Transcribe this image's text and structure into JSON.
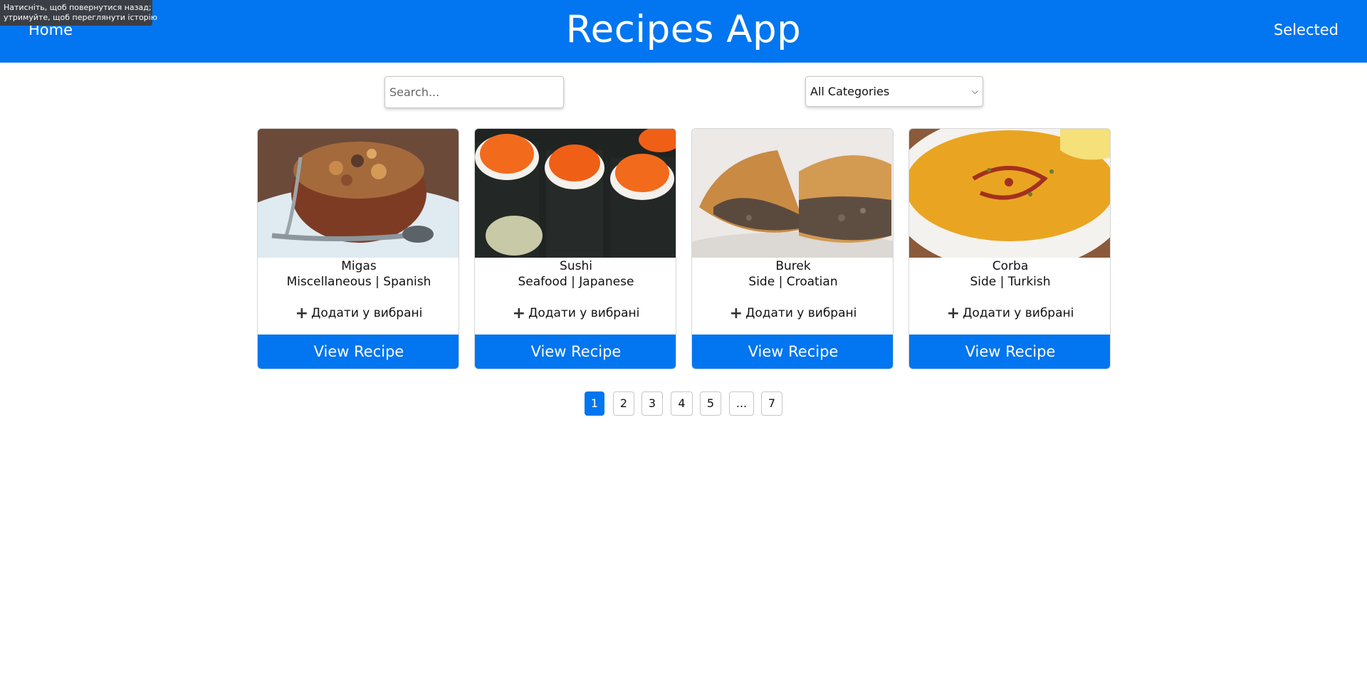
{
  "tooltip": {
    "line1": "Натисніть, щоб повернутися назад;",
    "line2": "утримуйте, щоб переглянути історію"
  },
  "header": {
    "home_label": "Home",
    "title": "Recipes App",
    "selected_label": "Selected"
  },
  "controls": {
    "search_placeholder": "Search...",
    "category_selected": "All Categories"
  },
  "cards": [
    {
      "title": "Migas",
      "meta": "Miscellaneous | Spanish",
      "fav_label": "Додати у вибрані",
      "view_label": "View Recipe",
      "image": "migas-dish-photo"
    },
    {
      "title": "Sushi",
      "meta": "Seafood | Japanese",
      "fav_label": "Додати у вибрані",
      "view_label": "View Recipe",
      "image": "sushi-rolls-photo"
    },
    {
      "title": "Burek",
      "meta": "Side | Croatian",
      "fav_label": "Додати у вибрані",
      "view_label": "View Recipe",
      "image": "burek-pastry-photo"
    },
    {
      "title": "Corba",
      "meta": "Side | Turkish",
      "fav_label": "Додати у вибрані",
      "view_label": "View Recipe",
      "image": "corba-soup-photo"
    }
  ],
  "pagination": {
    "pages": [
      "1",
      "2",
      "3",
      "4",
      "5",
      "...",
      "7"
    ],
    "current": "1"
  },
  "colors": {
    "primary": "#0275f0"
  }
}
